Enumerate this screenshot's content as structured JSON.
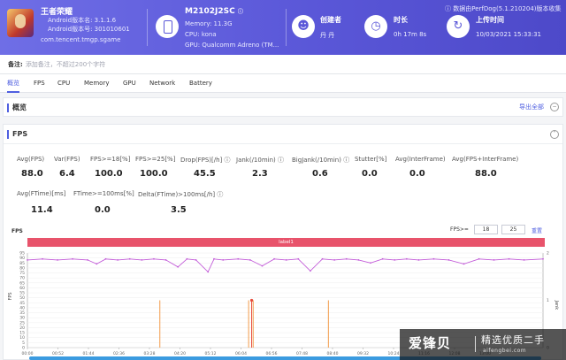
{
  "app": {
    "name": "王者荣耀",
    "version_label": "Android版本名: 3.1.1.6",
    "code_label": "Android版本号: 301010601",
    "package": "com.tencent.tmgp.sgame"
  },
  "device": {
    "model": "M2102J2SC",
    "memory": "Memory: 11.3G",
    "cpu": "CPU: kona",
    "gpu": "GPU: Qualcomm Adreno (TM..."
  },
  "creator": {
    "label": "创建者",
    "value": "丹 丹"
  },
  "duration": {
    "label": "时长",
    "value": "0h 17m 8s"
  },
  "upload": {
    "label": "上传时间",
    "value": "10/03/2021 15:33:31"
  },
  "perfdog_version": "数据由PerfDog(5.1.210204)版本收集",
  "note": {
    "label": "备注:",
    "placeholder": "添加备注，不超过200个字符"
  },
  "tabs": [
    "概览",
    "FPS",
    "CPU",
    "Memory",
    "GPU",
    "Network",
    "Battery"
  ],
  "active_tab": 0,
  "overview": {
    "title": "概览",
    "export_label": "导出全部"
  },
  "fps": {
    "title": "FPS",
    "metrics_row1": [
      {
        "label": "Avg(FPS)",
        "value": "88.0"
      },
      {
        "label": "Var(FPS)",
        "value": "6.4"
      },
      {
        "label": "FPS>=18[%]",
        "value": "100.0"
      },
      {
        "label": "FPS>=25[%]",
        "value": "100.0"
      },
      {
        "label": "Drop(FPS)[/h]",
        "value": "45.5"
      },
      {
        "label": "Jank(/10min)",
        "value": "2.3"
      },
      {
        "label": "BigJank(/10min)",
        "value": "0.6"
      },
      {
        "label": "Stutter[%]",
        "value": "0.0"
      },
      {
        "label": "Avg(InterFrame)",
        "value": "0.0"
      },
      {
        "label": "Avg(FPS+InterFrame)",
        "value": "88.0"
      }
    ],
    "metrics_row2": [
      {
        "label": "Avg(FTime)[ms]",
        "value": "11.4"
      },
      {
        "label": "FTime>=100ms[%]",
        "value": "0.0"
      },
      {
        "label": "Delta(FTime)>100ms[/h]",
        "value": "3.5"
      }
    ]
  },
  "chart": {
    "title": "FPS",
    "threshold_label": "FPS>=",
    "threshold_low": "18",
    "threshold_high": "25",
    "reset_label": "重置",
    "label_bar": "label1",
    "ylabel": "FPS",
    "y2label": "Jank",
    "colors": {
      "fps": "#c25ad8",
      "jank": "#f39c4a",
      "bigjank": "#e74c3c",
      "label": "#e8536b",
      "axis": "#999999"
    }
  },
  "chart_data": {
    "type": "line",
    "title": "FPS",
    "xlabel": "",
    "ylabel": "FPS",
    "y2label": "Jank",
    "ylim": [
      0,
      95
    ],
    "y2lim": [
      0,
      2
    ],
    "yticks": [
      0,
      5,
      10,
      15,
      20,
      25,
      30,
      35,
      40,
      45,
      50,
      55,
      60,
      65,
      70,
      75,
      80,
      85,
      90,
      95
    ],
    "y2ticks": [
      0,
      1,
      2
    ],
    "x_ticks": [
      "00:00",
      "00:52",
      "01:44",
      "02:36",
      "03:28",
      "04:20",
      "05:12",
      "06:04",
      "06:56",
      "07:48",
      "08:40",
      "09:32",
      "10:24",
      "11:16",
      "12:08",
      "13:00"
    ],
    "series": [
      {
        "name": "FPS",
        "x_minutes": [
          0,
          0.5,
          1,
          1.5,
          2,
          2.3,
          2.6,
          3,
          3.4,
          3.8,
          4.2,
          4.6,
          5,
          5.3,
          5.6,
          6,
          6.2,
          6.5,
          7,
          7.4,
          7.8,
          8.2,
          8.6,
          9,
          9.4,
          9.8,
          10.2,
          10.6,
          11,
          11.4,
          11.8,
          12.2,
          12.6,
          13,
          13.5,
          14,
          14.5,
          15,
          15.5,
          16,
          16.5,
          17.13
        ],
        "values": [
          88,
          89,
          88,
          89,
          88,
          84,
          89,
          88,
          89,
          88,
          89,
          88,
          81,
          89,
          88,
          76,
          89,
          88,
          89,
          88,
          82,
          89,
          88,
          89,
          77,
          89,
          88,
          89,
          88,
          85,
          89,
          88,
          89,
          88,
          89,
          88,
          84,
          89,
          88,
          89,
          88,
          89
        ]
      },
      {
        "name": "Jank",
        "x_minutes": [
          4.4,
          7.35,
          7.5,
          10.0
        ],
        "values": [
          1,
          1,
          1,
          1
        ]
      },
      {
        "name": "BigJank",
        "x_minutes": [
          7.45
        ],
        "values": [
          1
        ]
      }
    ]
  },
  "watermark": {
    "big": "爱锋贝",
    "slogan": "精选优质二手",
    "url": "aifengbei.com"
  }
}
